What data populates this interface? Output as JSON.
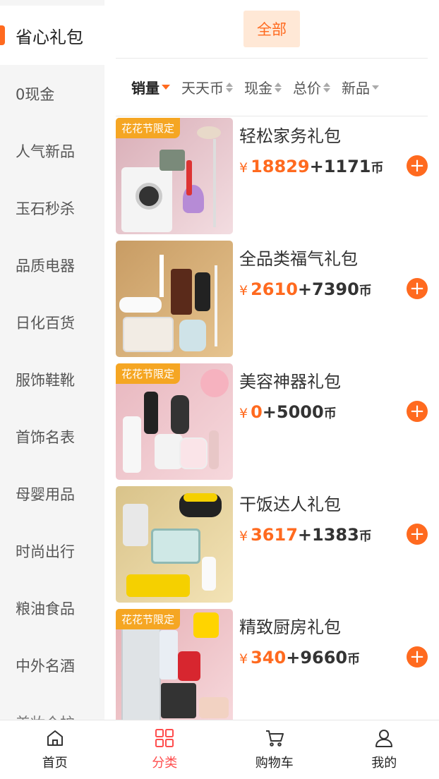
{
  "sidebar": {
    "items": [
      {
        "label": "省心礼包",
        "active": true
      },
      {
        "label": "0现金"
      },
      {
        "label": "人气新品"
      },
      {
        "label": "玉石秒杀"
      },
      {
        "label": "品质电器"
      },
      {
        "label": "日化百货"
      },
      {
        "label": "服饰鞋靴"
      },
      {
        "label": "首饰名表"
      },
      {
        "label": "母婴用品"
      },
      {
        "label": "时尚出行"
      },
      {
        "label": "粮油食品"
      },
      {
        "label": "中外名酒"
      },
      {
        "label": "美妆个护"
      }
    ]
  },
  "main": {
    "chip": "全部",
    "sort": [
      "销量",
      "天天币",
      "现金",
      "总价",
      "新品"
    ],
    "products": [
      {
        "name": "轻松家务礼包",
        "badge": "花花节限定",
        "cash": "18829",
        "coins": "+1171",
        "unit": "币",
        "yen": "¥"
      },
      {
        "name": "全品类福气礼包",
        "badge": "",
        "cash": "2610",
        "coins": "+7390",
        "unit": "币",
        "yen": "¥"
      },
      {
        "name": "美容神器礼包",
        "badge": "花花节限定",
        "cash": "0",
        "coins": "+5000",
        "unit": "币",
        "yen": "¥"
      },
      {
        "name": "干饭达人礼包",
        "badge": "",
        "cash": "3617",
        "coins": "+1383",
        "unit": "币",
        "yen": "¥"
      },
      {
        "name": "精致厨房礼包",
        "badge": "花花节限定",
        "cash": "340",
        "coins": "+9660",
        "unit": "币",
        "yen": "¥"
      }
    ]
  },
  "nav": {
    "items": [
      {
        "label": "首页",
        "icon": "home-icon"
      },
      {
        "label": "分类",
        "icon": "category-icon",
        "active": true
      },
      {
        "label": "购物车",
        "icon": "cart-icon"
      },
      {
        "label": "我的",
        "icon": "profile-icon"
      }
    ]
  },
  "colors": {
    "accent": "#ff6a1f",
    "badge": "#f5a623",
    "nav_active": "#ff4d4d"
  }
}
